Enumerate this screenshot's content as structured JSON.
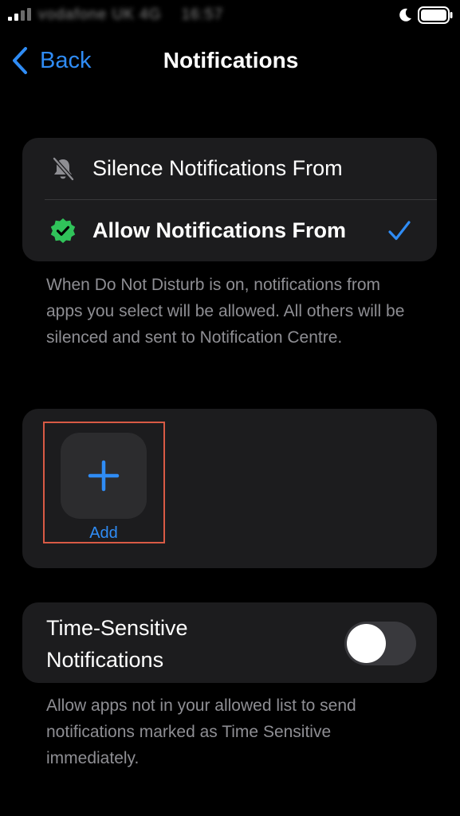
{
  "status_bar": {
    "carrier": "vodafone UK  4G",
    "time": "16:57"
  },
  "nav": {
    "back_label": "Back",
    "title": "Notifications"
  },
  "modes": [
    {
      "label": "Silence Notifications From",
      "icon": "bell-slash-icon",
      "selected": false
    },
    {
      "label": "Allow Notifications From",
      "icon": "checkmark-seal-icon",
      "selected": true
    }
  ],
  "modes_footnote": "When Do Not Disturb is on, notifications from apps you select will be allowed. All others will be silenced and sent to Notification Centre.",
  "apps": {
    "add_label": "Add",
    "add_icon": "plus-icon"
  },
  "time_sensitive": {
    "label": "Time-Sensitive Notifications",
    "enabled": false,
    "footnote": "Allow apps not in your allowed list to send notifications marked as Time Sensitive immediately."
  },
  "colors": {
    "accent": "#2f8cf5",
    "seal_green": "#30c35a",
    "card_bg": "#1c1c1e",
    "highlight": "#d85a45"
  }
}
